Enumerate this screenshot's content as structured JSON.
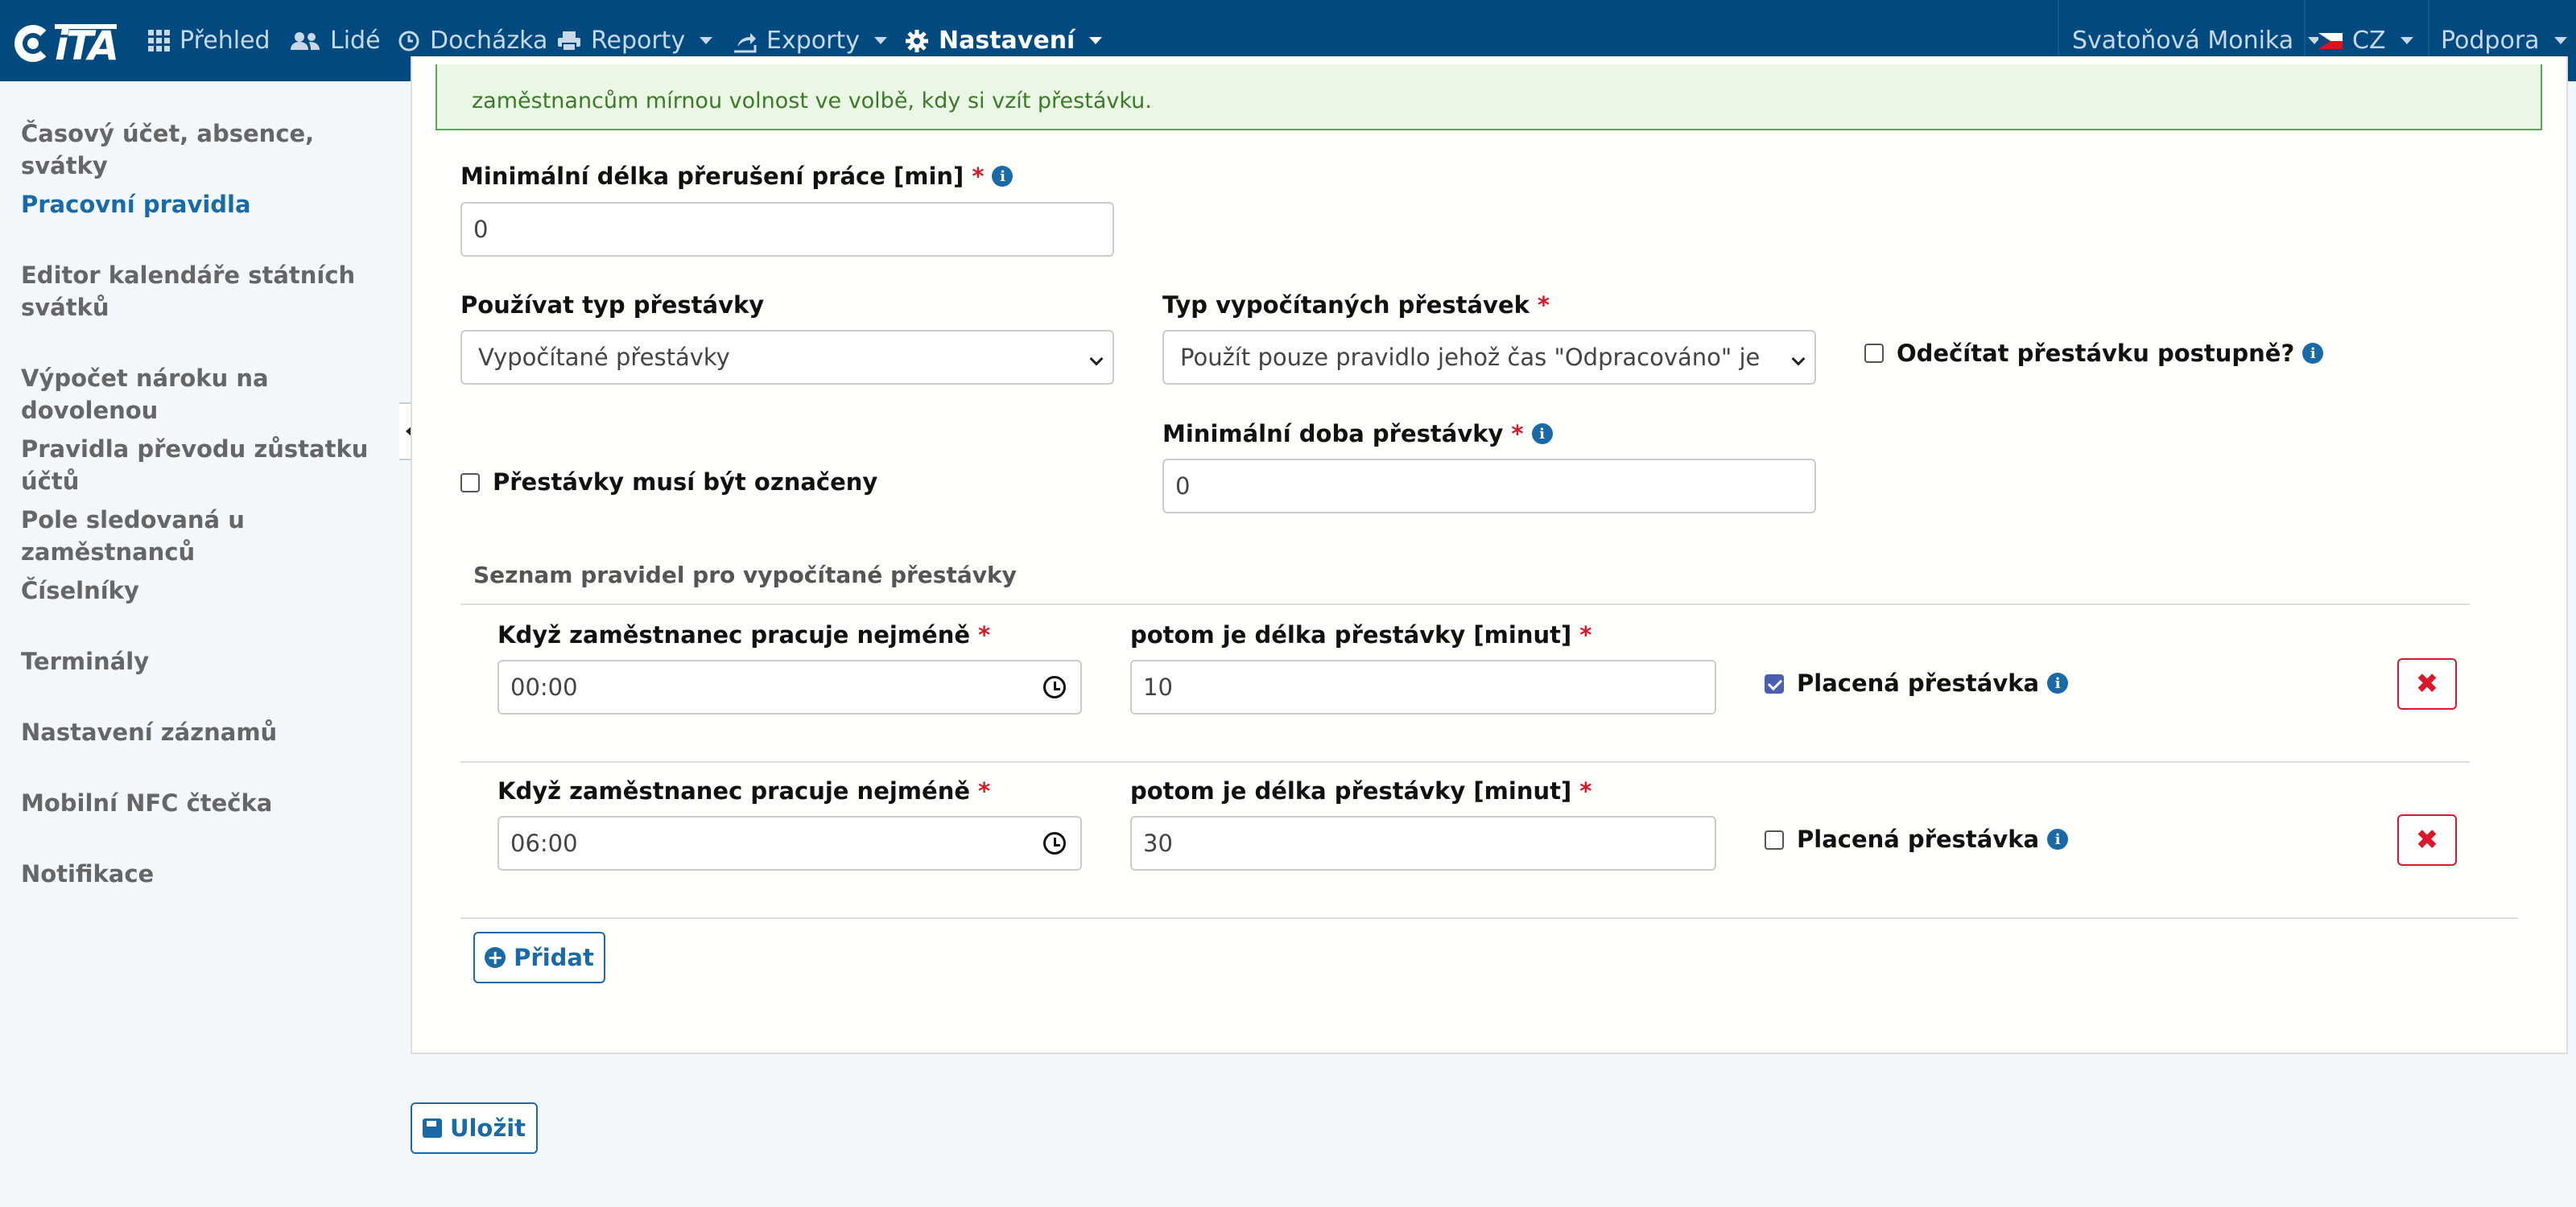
{
  "navbar": {
    "logo_text": "iTA",
    "items": [
      {
        "label": "Přehled",
        "icon": "grid-icon"
      },
      {
        "label": "Lidé",
        "icon": "users-icon"
      },
      {
        "label": "Docházka",
        "icon": "clock-icon"
      },
      {
        "label": "Reporty",
        "icon": "printer-icon"
      },
      {
        "label": "Exporty",
        "icon": "export-icon"
      },
      {
        "label": "Nastavení",
        "icon": "gear-icon"
      }
    ],
    "user": "Svatoňová Monika",
    "language": "CZ",
    "support": "Podpora"
  },
  "sidebar": {
    "items": [
      {
        "label": "Časový účet, absence, svátky"
      },
      {
        "label": "Pracovní pravidla"
      },
      {
        "label": "Editor kalendáře státních svátků"
      },
      {
        "label": "Výpočet nároku na dovolenou"
      },
      {
        "label": "Pravidla převodu zůstatku účtů"
      },
      {
        "label": "Pole sledovaná u zaměstnanců"
      },
      {
        "label": "Číselníky"
      },
      {
        "label": "Terminály"
      },
      {
        "label": "Nastavení záznamů"
      },
      {
        "label": "Mobilní NFC čtečka"
      },
      {
        "label": "Notifikace"
      }
    ]
  },
  "alert": {
    "text": "zaměstnancům mírnou volnost ve volbě, kdy si vzít přestávku."
  },
  "form": {
    "min_interruption": {
      "label": "Minimální délka přerušení práce [min]",
      "value": "0"
    },
    "break_type": {
      "label": "Používat typ přestávky",
      "value": "Vypočítané přestávky"
    },
    "calc_break_type": {
      "label": "Typ vypočítaných přestávek",
      "value": "Použít pouze pravidlo jehož čas \"Odpracováno\" je nejvyšší"
    },
    "deduct_gradually": {
      "label": "Odečítat přestávku postupně?"
    },
    "breaks_marked": {
      "label": "Přestávky musí být označeny"
    },
    "min_break": {
      "label": "Minimální doba přestávky",
      "value": "0"
    }
  },
  "rules": {
    "title": "Seznam pravidel pro vypočítané přestávky",
    "work_label": "Když zaměstnanec pracuje nejméně",
    "break_label": "potom je délka přestávky [minut]",
    "paid_label": "Placená přestávka",
    "rows": [
      {
        "work_time": "00:00",
        "break_minutes": "10",
        "paid": true
      },
      {
        "work_time": "06:00",
        "break_minutes": "30",
        "paid": false
      }
    ],
    "delete_symbol": "✖",
    "add_label": "Přidat"
  },
  "save_label": "Uložit",
  "colors": {
    "navbar": "#004a80",
    "accent": "#1a6aa8",
    "danger": "#d9182b",
    "success": "#4caf50"
  }
}
